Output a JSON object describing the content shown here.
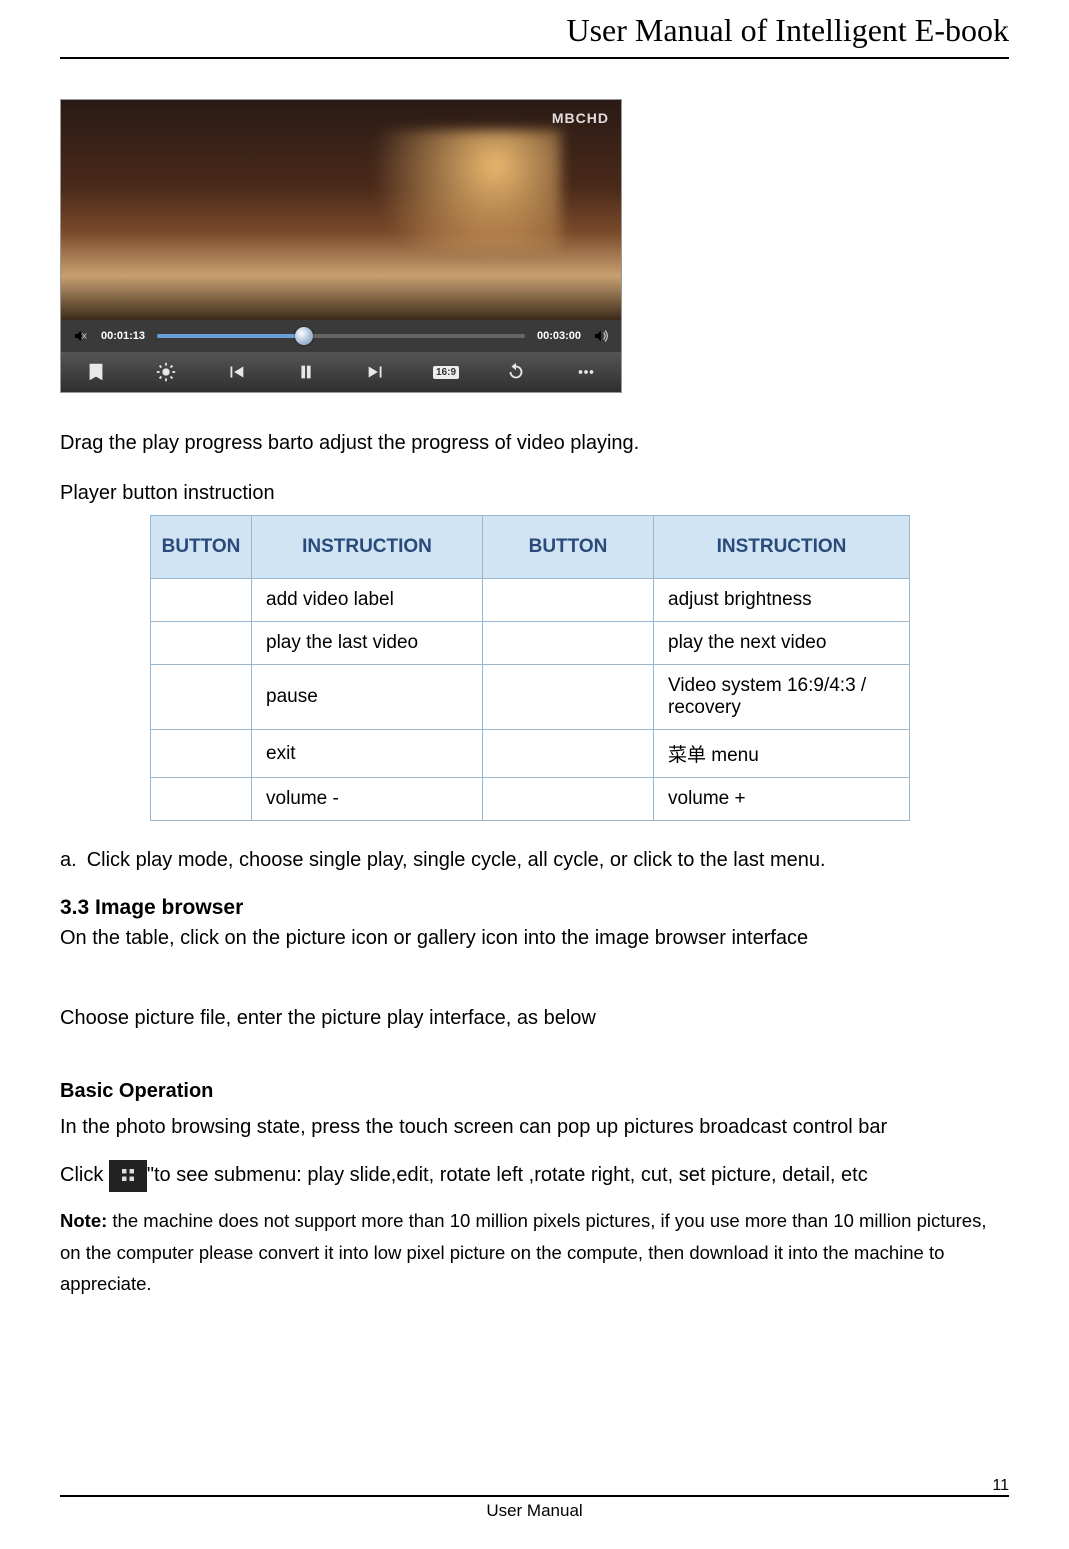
{
  "header": {
    "title": "User Manual of Intelligent E-book"
  },
  "player": {
    "watermark": "MBCHD",
    "time_current": "00:01:13",
    "time_total": "00:03:00",
    "aspect_badge": "16:9"
  },
  "captions": {
    "drag_text": "Drag the play progress barto adjust the progress of video playing.",
    "table_intro": "Player button instruction"
  },
  "table": {
    "headers": [
      "BUTTON",
      "INSTRUCTION",
      "BUTTON",
      "INSTRUCTION"
    ],
    "rows": [
      {
        "btn1": "",
        "inst1": "add video label",
        "btn2": "",
        "inst2": "adjust brightness"
      },
      {
        "btn1": "",
        "inst1": "play the last video",
        "btn2": "",
        "inst2": "play the next video"
      },
      {
        "btn1": "",
        "inst1": "pause",
        "btn2": "",
        "inst2": "Video system 16:9/4:3 / recovery"
      },
      {
        "btn1": "",
        "inst1": "exit",
        "btn2": "",
        "inst2": "菜单 menu"
      },
      {
        "btn1": "",
        "inst1": "volume -",
        "btn2": "",
        "inst2": "volume +"
      }
    ]
  },
  "list": {
    "marker_a": "a.",
    "item_a": "Click play mode, choose single play, single cycle, all cycle, or click to the last menu."
  },
  "sections": {
    "s33_title": "3.3 Image browser",
    "s33_body1": "On the table, click on the picture icon or gallery icon into the image browser interface",
    "s33_body2": "Choose picture file, enter the picture play interface, as below",
    "basic_title": "Basic Operation",
    "basic_body1": "In the photo browsing state, press the touch screen can pop up pictures broadcast control bar",
    "click_prefix": "Click ",
    "click_suffix": "\"to see submenu: play slide,edit, rotate left ,rotate right, cut, set picture, detail, etc",
    "note_label": "Note:",
    "note_body": " the machine does not support more than 10 million pixels pictures, if you use more than 10 million pictures, on the computer please convert it into low pixel picture on the compute, then download it into the machine to appreciate."
  },
  "footer": {
    "label": "User Manual",
    "page": "11"
  }
}
